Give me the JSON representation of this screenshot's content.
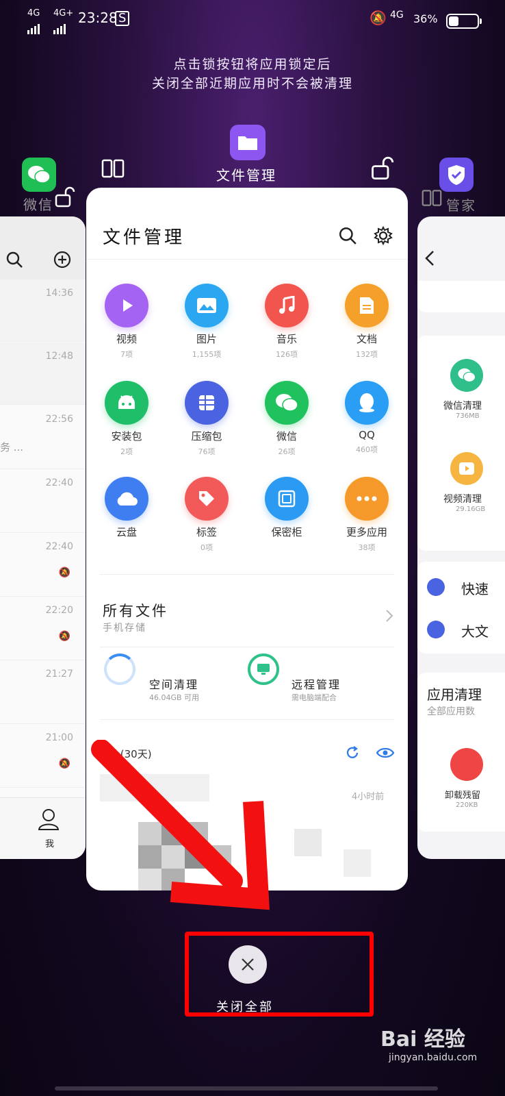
{
  "status": {
    "net1": "4G",
    "net2": "4G+",
    "time": "23:28",
    "net3": "4G",
    "battery": "36%",
    "battery_level": 0.36
  },
  "hint": {
    "line1": "点击锁按钮将应用锁定后",
    "line2": "关闭全部近期应用时不会被清理"
  },
  "apps": {
    "left": "微信",
    "center": "文件管理",
    "right": "管家"
  },
  "wechat": {
    "times": [
      "14:36",
      "12:48",
      "22:56",
      "22:40",
      "22:40",
      "22:20",
      "21:27",
      "21:00"
    ],
    "snippet": "务 ...",
    "me_label": "我"
  },
  "files": {
    "title": "文件管理",
    "categories": [
      {
        "label": "视频",
        "count": "7项",
        "color": "#a463f2"
      },
      {
        "label": "图片",
        "count": "1,155项",
        "color": "#2aa7f0"
      },
      {
        "label": "音乐",
        "count": "126项",
        "color": "#f2544e"
      },
      {
        "label": "文档",
        "count": "132项",
        "color": "#f5a02a"
      },
      {
        "label": "安装包",
        "count": "2项",
        "color": "#1fbf6a"
      },
      {
        "label": "压缩包",
        "count": "76项",
        "color": "#4a63e0"
      },
      {
        "label": "微信",
        "count": "26项",
        "color": "#1fc25c"
      },
      {
        "label": "QQ",
        "count": "460项",
        "color": "#2a9ef5"
      },
      {
        "label": "云盘",
        "count": "",
        "color": "#3f7ef0"
      },
      {
        "label": "标签",
        "count": "0项",
        "color": "#f25a5a"
      },
      {
        "label": "保密柜",
        "count": "",
        "color": "#2b9af2"
      },
      {
        "label": "更多应用",
        "count": "38项",
        "color": "#f59a2a"
      }
    ],
    "all_files": "所有文件",
    "all_files_sub": "手机存储",
    "space_clean": "空间清理",
    "space_sub": "46.04GB 可用",
    "remote": "远程管理",
    "remote_sub": "需电脑端配合",
    "recent": "近 (30天)",
    "recent_time": "4小时前"
  },
  "manager": {
    "wx_clean": "微信清理",
    "wx_size": "736MB",
    "video_clean": "视频清理",
    "video_size": "29.16GB",
    "quick": "快速",
    "big": "大文",
    "app_clean": "应用清理",
    "app_sub": "全部应用数",
    "uninstall": "卸载残留",
    "uninstall_size": "220KB"
  },
  "close_all": "关闭全部",
  "watermark": "Bai 经验",
  "watermark_url": "jingyan.baidu.com"
}
